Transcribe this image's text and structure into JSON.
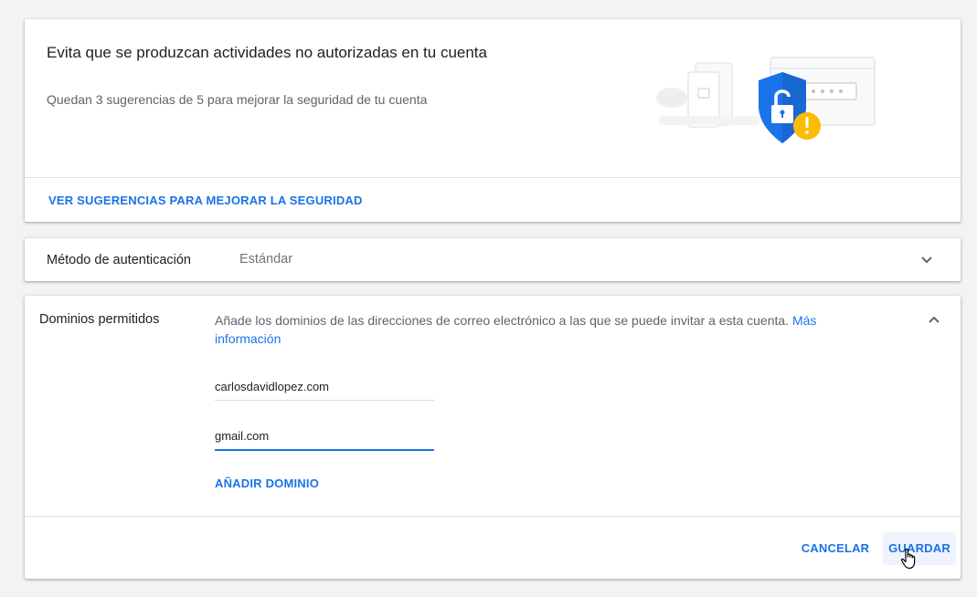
{
  "security_card": {
    "title": "Evita que se produzcan actividades no autorizadas en tu cuenta",
    "subtitle": "Quedan 3 sugerencias de 5 para mejorar la seguridad de tu cuenta",
    "link": "VER SUGERENCIAS PARA MEJORAR LA SEGURIDAD",
    "illustration_icon": "shield-lock-icon",
    "alert_icon": "warning-icon"
  },
  "auth_card": {
    "label": "Método de autenticación",
    "value": "Estándar",
    "toggle_icon": "chevron-down-icon"
  },
  "domains_card": {
    "label": "Dominios permitidos",
    "description": "Añade los dominios de las direcciones de correo electrónico a las que se puede invitar a esta cuenta.",
    "more_info": "Más información",
    "toggle_icon": "chevron-up-icon",
    "domains": [
      "carlosdavidlopez.com",
      "gmail.com"
    ],
    "add_domain": "AÑADIR DOMINIO",
    "cancel": "CANCELAR",
    "save": "GUARDAR"
  },
  "colors": {
    "accent": "#1a73e8",
    "shield": "#1a73e8",
    "warning": "#fbbc04",
    "background": "#f1f3f4"
  }
}
